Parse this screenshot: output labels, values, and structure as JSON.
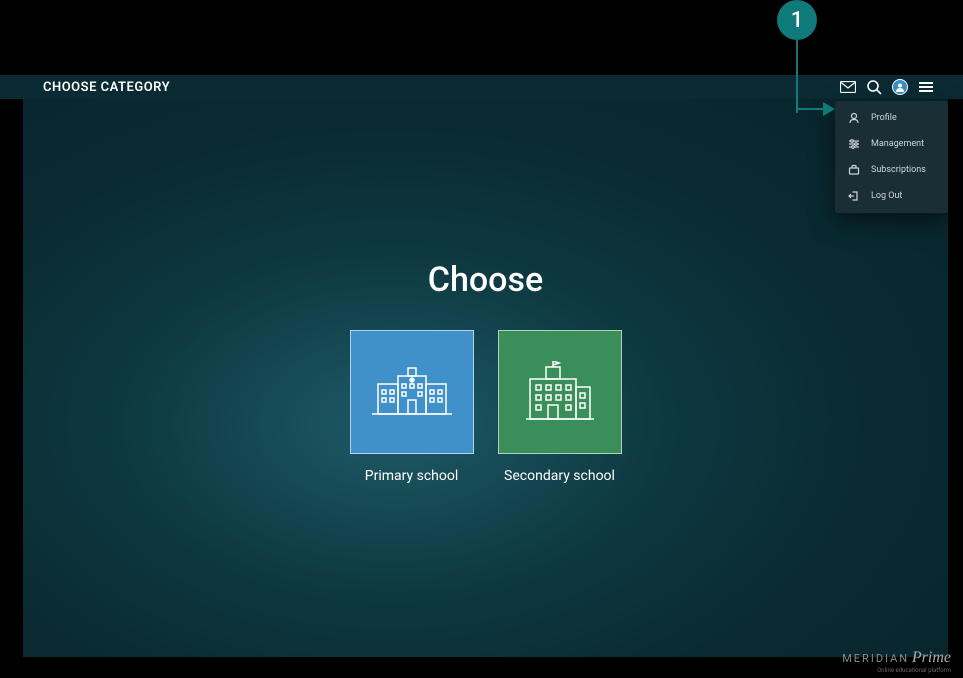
{
  "annotation": {
    "number": "1"
  },
  "header": {
    "title": "CHOOSE CATEGORY"
  },
  "dropdown": {
    "items": [
      {
        "label": "Profile"
      },
      {
        "label": "Management"
      },
      {
        "label": "Subscriptions"
      },
      {
        "label": "Log Out"
      }
    ]
  },
  "main": {
    "title": "Choose",
    "cards": [
      {
        "label": "Primary school"
      },
      {
        "label": "Secondary school"
      }
    ]
  },
  "footer": {
    "brand": "MERIDIAN",
    "prime": "Prime",
    "sub": "Online educational platform"
  }
}
